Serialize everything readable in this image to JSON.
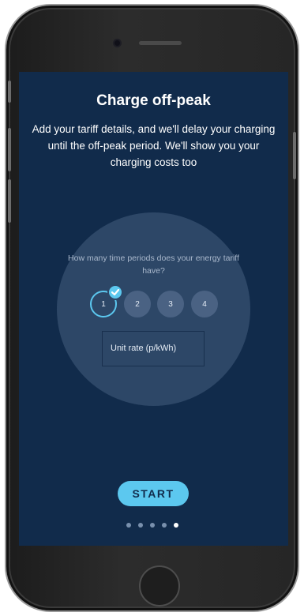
{
  "screen": {
    "title": "Charge off-peak",
    "subtitle": "Add your tariff details, and we'll delay your charging until the off-peak period. We'll show you your charging costs too",
    "question": "How many time periods does your energy tariff have?",
    "periods": [
      {
        "label": "1",
        "selected": true
      },
      {
        "label": "2",
        "selected": false
      },
      {
        "label": "3",
        "selected": false
      },
      {
        "label": "4",
        "selected": false
      }
    ],
    "unit_rate_placeholder": "Unit rate (p/kWh)",
    "start_label": "START",
    "pagination": {
      "total": 5,
      "active": 5
    }
  },
  "icons": {
    "check": "checkmark-icon"
  },
  "colors": {
    "background": "#112b4b",
    "circle": "#2d4767",
    "accent": "#5cc8ef",
    "period": "#4a6283"
  }
}
